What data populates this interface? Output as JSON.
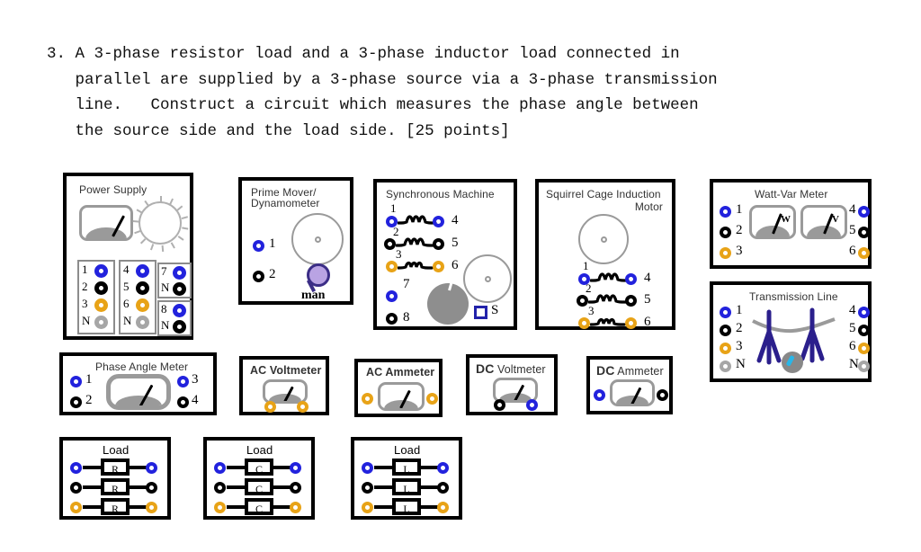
{
  "problem": {
    "text": "3. A 3-phase resistor load and a 3-phase inductor load connected in\n   parallel are supplied by a 3-phase source via a 3-phase transmission\n   line.   Construct a circuit which measures the phase angle between\n   the source side and the load side. [25 points]"
  },
  "panels": {
    "power_supply": {
      "title": "Power Supply",
      "terminals_group1": [
        {
          "label": "1",
          "color": "blue"
        },
        {
          "label": "2",
          "color": "black"
        },
        {
          "label": "3",
          "color": "amber"
        },
        {
          "label": "N",
          "color": "gray"
        }
      ],
      "terminals_group2": [
        {
          "label": "4",
          "color": "blue"
        },
        {
          "label": "5",
          "color": "black"
        },
        {
          "label": "6",
          "color": "amber"
        },
        {
          "label": "N",
          "color": "gray"
        }
      ],
      "terminals_group3": [
        {
          "label": "7",
          "color": "blue"
        },
        {
          "label": "N",
          "color": "black"
        }
      ],
      "terminals_group4": [
        {
          "label": "8",
          "color": "blue"
        },
        {
          "label": "N",
          "color": "black"
        }
      ]
    },
    "prime_mover": {
      "title_line1": "Prime Mover/",
      "title_line2": "Dynamometer",
      "terminals": [
        {
          "label": "1",
          "color": "blue"
        },
        {
          "label": "2",
          "color": "black"
        }
      ],
      "knob_label": "man"
    },
    "synchronous_machine": {
      "title": "Synchronous Machine",
      "winding_pairs": [
        {
          "left_label": "1",
          "right_label": "4",
          "color": "blue"
        },
        {
          "left_label": "2",
          "right_label": "5",
          "color": "black"
        },
        {
          "left_label": "3",
          "right_label": "6",
          "color": "amber"
        }
      ],
      "terminals": [
        {
          "label": "7",
          "color": "blue"
        },
        {
          "label": "8",
          "color": "black"
        }
      ],
      "square_terminal_label": "S"
    },
    "squirrel_cage": {
      "title_line1": "Squirrel Cage  Induction",
      "title_line2": "Motor",
      "winding_pairs": [
        {
          "left_label": "1",
          "right_label": "4",
          "color": "blue"
        },
        {
          "left_label": "2",
          "right_label": "5",
          "color": "black"
        },
        {
          "left_label": "3",
          "right_label": "6",
          "color": "amber"
        }
      ]
    },
    "watt_var_meter": {
      "title": "Watt-Var Meter",
      "left_terminals": [
        {
          "label": "1",
          "color": "blue"
        },
        {
          "label": "2",
          "color": "black"
        },
        {
          "label": "3",
          "color": "amber"
        }
      ],
      "right_terminals": [
        {
          "label": "4",
          "color": "blue"
        },
        {
          "label": "5",
          "color": "black"
        },
        {
          "label": "6",
          "color": "amber"
        }
      ],
      "gauge_left_label": "W",
      "gauge_right_label": "V"
    },
    "transmission_line": {
      "title": "Transmission Line",
      "left_terminals": [
        {
          "label": "1",
          "color": "blue"
        },
        {
          "label": "2",
          "color": "black"
        },
        {
          "label": "3",
          "color": "amber"
        },
        {
          "label": "N",
          "color": "gray"
        }
      ],
      "right_terminals": [
        {
          "label": "4",
          "color": "blue"
        },
        {
          "label": "5",
          "color": "black"
        },
        {
          "label": "6",
          "color": "amber"
        },
        {
          "label": "N",
          "color": "gray"
        }
      ]
    },
    "phase_angle_meter": {
      "title": "Phase Angle Meter",
      "terminals": [
        {
          "label": "1",
          "color": "blue"
        },
        {
          "label": "2",
          "color": "black"
        },
        {
          "label": "3",
          "color": "blue"
        },
        {
          "label": "4",
          "color": "black"
        }
      ]
    },
    "ac_voltmeter": {
      "title": "AC Voltmeter",
      "terminals": [
        {
          "color": "amber"
        },
        {
          "color": "amber"
        }
      ]
    },
    "ac_ammeter": {
      "title": "AC Ammeter",
      "terminals": [
        {
          "color": "amber"
        },
        {
          "color": "amber"
        }
      ]
    },
    "dc_voltmeter": {
      "title_bold": "DC",
      "title_rest": " Voltmeter",
      "terminals": [
        {
          "color": "black"
        },
        {
          "color": "blue"
        }
      ]
    },
    "dc_ammeter": {
      "title_bold": "DC",
      "title_rest": " Ammeter",
      "terminals": [
        {
          "color": "blue"
        },
        {
          "color": "black"
        }
      ]
    },
    "load_r": {
      "title": "Load",
      "element_symbol": "R",
      "rows": [
        {
          "color": "blue"
        },
        {
          "color": "black"
        },
        {
          "color": "amber"
        }
      ]
    },
    "load_c": {
      "title": "Load",
      "element_symbol": "C",
      "rows": [
        {
          "color": "blue"
        },
        {
          "color": "black"
        },
        {
          "color": "amber"
        }
      ]
    },
    "load_l": {
      "title": "Load",
      "element_symbol": "L",
      "rows": [
        {
          "color": "blue"
        },
        {
          "color": "black"
        },
        {
          "color": "amber"
        }
      ]
    }
  },
  "colors": {
    "blue": "#2222dd",
    "black": "#000000",
    "amber": "#e8a317",
    "gray": "#a6a6a6",
    "panel_border": "#000000",
    "gauge_gray": "#9a9a9a",
    "tower_blue": "#2b1f8c",
    "knob_purple": "#b9a3e3",
    "knob_pointer": "#29b6e8"
  }
}
